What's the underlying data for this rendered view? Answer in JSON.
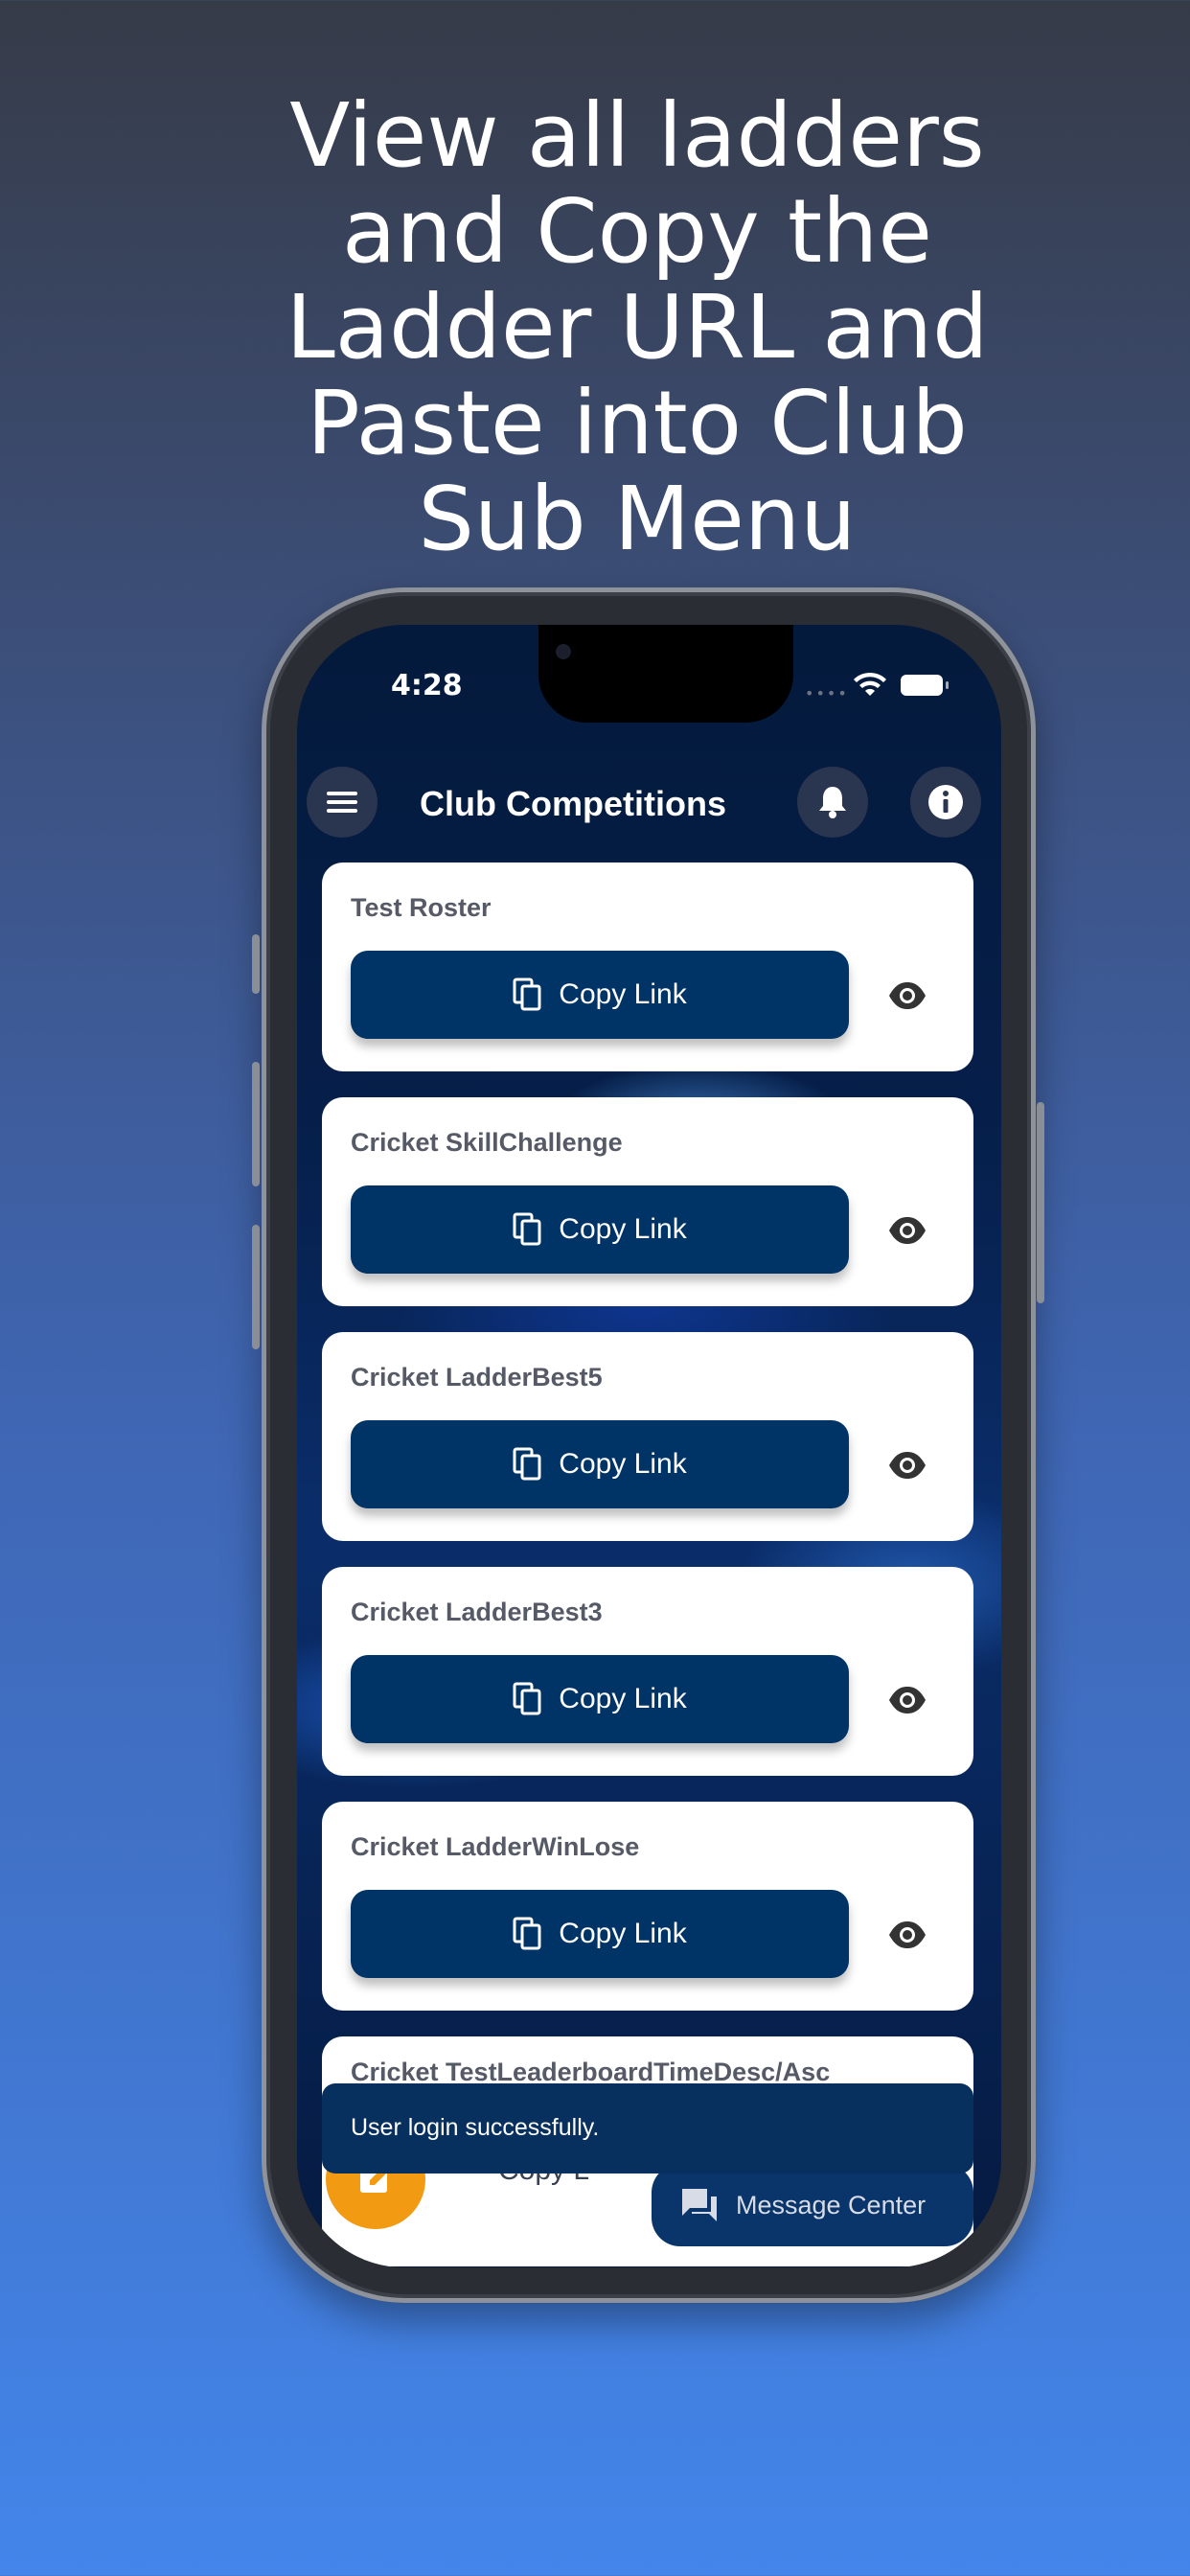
{
  "headline": {
    "line1": "View all ladders",
    "line2": "and Copy the",
    "line3": "Ladder URL and",
    "line4": "Paste into Club",
    "line5": "Sub Menu"
  },
  "status_bar": {
    "time": "4:28"
  },
  "app_bar": {
    "title": "Club Competitions",
    "menu_icon": "menu-icon",
    "notification_icon": "bell-icon",
    "info_icon": "info-icon"
  },
  "cards": [
    {
      "title": "Test Roster",
      "button_label": "Copy Link"
    },
    {
      "title": "Cricket SkillChallenge",
      "button_label": "Copy Link"
    },
    {
      "title": "Cricket LadderBest5",
      "button_label": "Copy Link"
    },
    {
      "title": "Cricket LadderBest3",
      "button_label": "Copy Link"
    },
    {
      "title": "Cricket LadderWinLose",
      "button_label": "Copy Link"
    },
    {
      "title": "Cricket TestLeaderboardTimeDesc/Asc",
      "button_label": "Copy L"
    }
  ],
  "snackbar": {
    "message": "User login successfully."
  },
  "message_center": {
    "label": "Message Center"
  },
  "colors": {
    "primary_button": "#003366",
    "fab": "#f29b12",
    "card": "#ffffff"
  }
}
